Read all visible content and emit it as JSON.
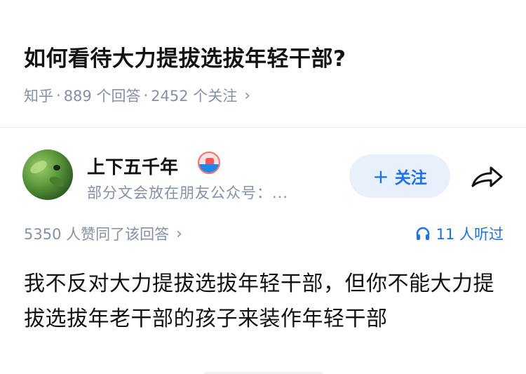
{
  "question": {
    "title": "如何看待大力提拔选拔年轻干部?",
    "source": "知乎",
    "separator": "·",
    "answer_count": "889 个回答",
    "follower_count": "2452 个关注",
    "chevron": "›"
  },
  "answer": {
    "author_name": "上下五千年",
    "author_desc": "部分文会放在朋友公众号：...",
    "follow_label": "关注",
    "follow_icon": "+",
    "votes_text": "5350 人赞同了该回答",
    "listen_text": "11 人听过",
    "content": "我不反对大力提拔选拔年轻干部，但你不能大力提拔选拔年老干部的孩子来装作年轻干部"
  },
  "colors": {
    "accent": "#1772f6",
    "follow_bg": "#e8f0fc",
    "meta_text": "#8590a6",
    "title_text": "#121212"
  },
  "icons": {
    "share": "share-arrow-icon",
    "listen": "headphones-icon",
    "badge": "creator-badge-icon"
  }
}
